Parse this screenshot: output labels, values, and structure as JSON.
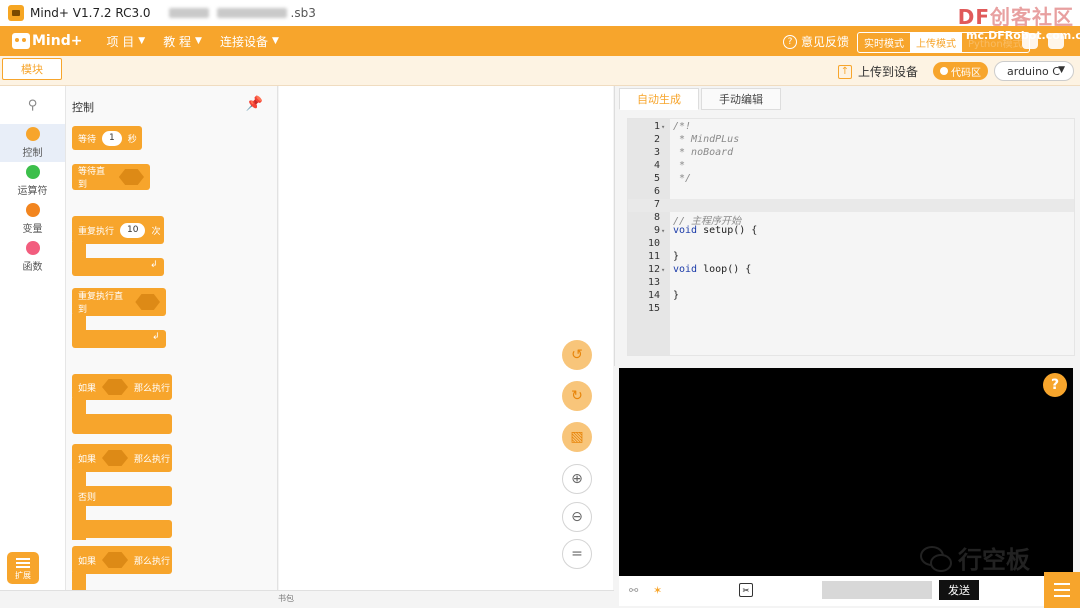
{
  "window": {
    "title": "Mind+ V1.7.2 RC3.0",
    "file_suffix": ".sb3",
    "watermark_df": "DF",
    "watermark_text": "创客社区",
    "watermark_url": "mc.DFRobot.com.cn"
  },
  "menubar": {
    "logo": "Mind+",
    "items": [
      "项 目",
      "教 程",
      "连接设备"
    ],
    "feedback": "意见反馈",
    "modes": [
      "实时模式",
      "上传模式",
      "Python模式"
    ],
    "active_mode": "上传模式"
  },
  "toolbar": {
    "blocks_tab": "模块",
    "upload": "上传到设备",
    "code_toggle": "代码区",
    "board": "arduino C"
  },
  "categories": [
    {
      "label": "控制",
      "color": "#f7a52c"
    },
    {
      "label": "运算符",
      "color": "#3cbf4b"
    },
    {
      "label": "变量",
      "color": "#f2851f"
    },
    {
      "label": "函数",
      "color": "#f25d7e"
    }
  ],
  "palette": {
    "title": "控制",
    "wait_label": "等待",
    "wait_value": "1",
    "wait_unit": "秒",
    "wait_until": "等待直到",
    "repeat_label": "重复执行",
    "repeat_value": "10",
    "repeat_unit": "次",
    "repeat_until": "重复执行直到",
    "if1": "如果",
    "then1": "那么执行",
    "if2": "如果",
    "then2": "那么执行",
    "else2": "否则",
    "if3": "如果",
    "then3": "那么执行",
    "extension": "扩展"
  },
  "workspace": {
    "backpack": "书包"
  },
  "code_panel": {
    "tabs": [
      "自动生成",
      "手动编辑"
    ],
    "lines": [
      {
        "n": "1",
        "fold": "▾",
        "text": "/*!",
        "cls": "c-comment"
      },
      {
        "n": "2",
        "fold": "",
        "text": " * MindPLus",
        "cls": "c-comment"
      },
      {
        "n": "3",
        "fold": "",
        "text": " * noBoard",
        "cls": "c-comment"
      },
      {
        "n": "4",
        "fold": "",
        "text": " *",
        "cls": "c-comment"
      },
      {
        "n": "5",
        "fold": "",
        "text": " */",
        "cls": "c-comment"
      },
      {
        "n": "6",
        "fold": "",
        "text": "",
        "cls": ""
      },
      {
        "n": "7",
        "fold": "",
        "text": "",
        "cls": ""
      },
      {
        "n": "8",
        "fold": "",
        "text": "// 主程序开始",
        "cls": "c-comment"
      },
      {
        "n": "9",
        "fold": "▾",
        "text": "void setup() {",
        "cls": "kwline"
      },
      {
        "n": "10",
        "fold": "",
        "text": "",
        "cls": ""
      },
      {
        "n": "11",
        "fold": "",
        "text": "}",
        "cls": ""
      },
      {
        "n": "12",
        "fold": "▾",
        "text": "void loop() {",
        "cls": "kwline"
      },
      {
        "n": "13",
        "fold": "",
        "text": "",
        "cls": ""
      },
      {
        "n": "14",
        "fold": "",
        "text": "}",
        "cls": ""
      },
      {
        "n": "15",
        "fold": "",
        "text": "",
        "cls": ""
      }
    ]
  },
  "serial": {
    "help": "?",
    "send": "发送"
  },
  "overlay_watermark": "行空板"
}
